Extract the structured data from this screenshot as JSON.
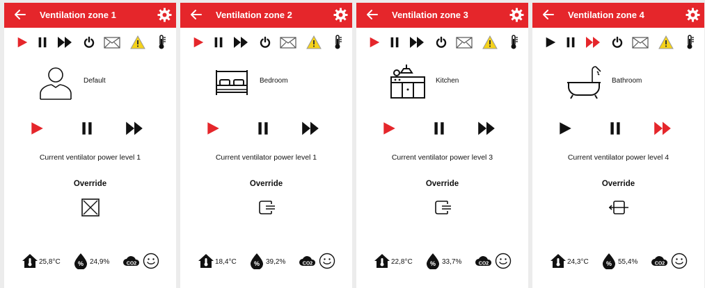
{
  "colors": {
    "accent": "#e5262b",
    "warning": "#f5d21a",
    "text": "#111111",
    "background": "#ececec"
  },
  "panels": [
    {
      "title": "Ventilation zone 1",
      "room": "Default",
      "room_icon": "person-icon",
      "power_text": "Current ventilator power level 1",
      "override_label": "Override",
      "override_icon": "override-disabled-icon",
      "active_mode": "play",
      "temperature": "25,8°C",
      "humidity": "24,9%"
    },
    {
      "title": "Ventilation zone 2",
      "room": "Bedroom",
      "room_icon": "bed-icon",
      "power_text": "Current ventilator power level 1",
      "override_label": "Override",
      "override_icon": "override-input-icon",
      "active_mode": "play",
      "temperature": "18,4°C",
      "humidity": "39,2%"
    },
    {
      "title": "Ventilation zone 3",
      "room": "Kitchen",
      "room_icon": "kitchen-icon",
      "power_text": "Current ventilator power level 3",
      "override_label": "Override",
      "override_icon": "override-input-icon",
      "active_mode": "play",
      "temperature": "22,8°C",
      "humidity": "33,7%"
    },
    {
      "title": "Ventilation zone 4",
      "room": "Bathroom",
      "room_icon": "bathtub-icon",
      "power_text": "Current ventilator power level 4",
      "override_label": "Override",
      "override_icon": "override-bidirectional-icon",
      "active_mode": "fast-forward",
      "temperature": "24,3°C",
      "humidity": "55,4%"
    }
  ]
}
